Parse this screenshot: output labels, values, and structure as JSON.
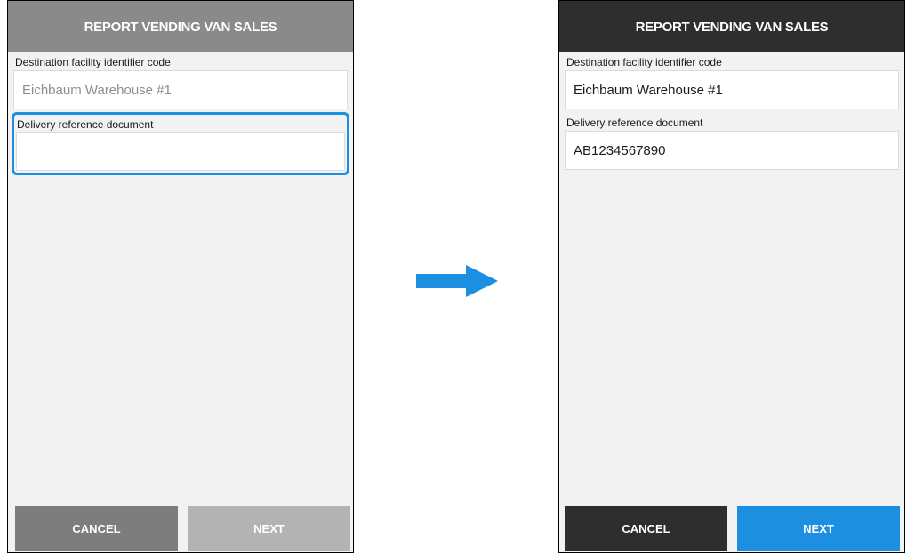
{
  "before": {
    "header": {
      "title": "REPORT VENDING VAN SALES"
    },
    "destination": {
      "label": "Destination facility identifier code",
      "value": "Eichbaum Warehouse #1"
    },
    "delivery": {
      "label": "Delivery reference document",
      "value": ""
    },
    "buttons": {
      "cancel": "CANCEL",
      "next": "NEXT"
    }
  },
  "after": {
    "header": {
      "title": "REPORT VENDING VAN SALES"
    },
    "destination": {
      "label": "Destination facility identifier code",
      "value": "Eichbaum Warehouse #1"
    },
    "delivery": {
      "label": "Delivery reference document",
      "value": "AB1234567890"
    },
    "buttons": {
      "cancel": "CANCEL",
      "next": "NEXT"
    }
  },
  "transition_icon": "right-arrow-icon",
  "colors": {
    "accent": "#1d8fe1",
    "header_before": "#8a8a8a",
    "header_after": "#2e2e2e",
    "disabled_button": "#b3b3b3",
    "screen_background": "#f2f2f2"
  }
}
